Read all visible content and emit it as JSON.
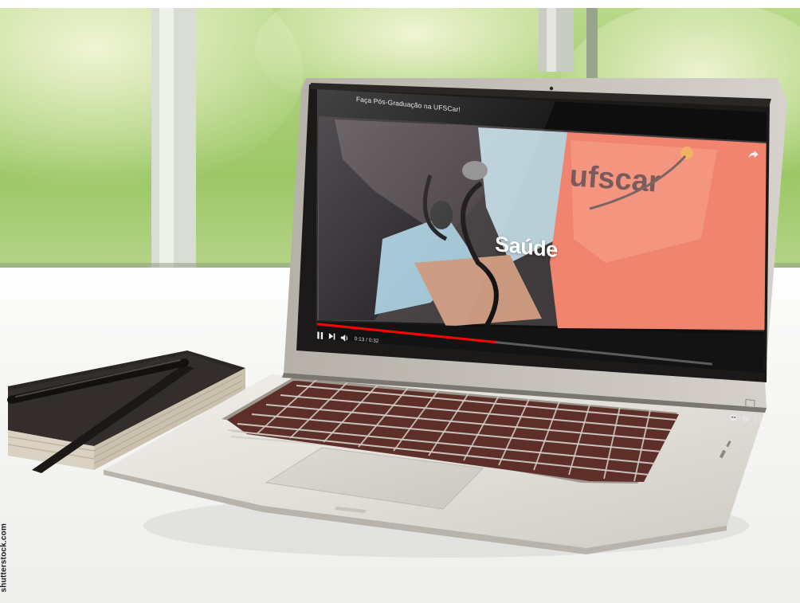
{
  "video": {
    "title": "Faça Pós-Graduação na UFSCar!",
    "overlay_text": "Saúde",
    "brand_text": "ufscar",
    "time": "0:13 / 0:32",
    "progress": 0.45
  },
  "icons": {
    "share": "share-icon",
    "play_pause": "pause-icon",
    "next": "next-icon",
    "volume": "volume-icon",
    "captions": "captions-icon",
    "settings": "gear-icon",
    "fullscreen": "fullscreen-icon",
    "collapse": "chevron-down-icon"
  },
  "watermark": "shutterstock.com",
  "colors": {
    "progress": "#ff0000",
    "scrub": "#ff5a4a",
    "shirt": "#f0846e"
  }
}
